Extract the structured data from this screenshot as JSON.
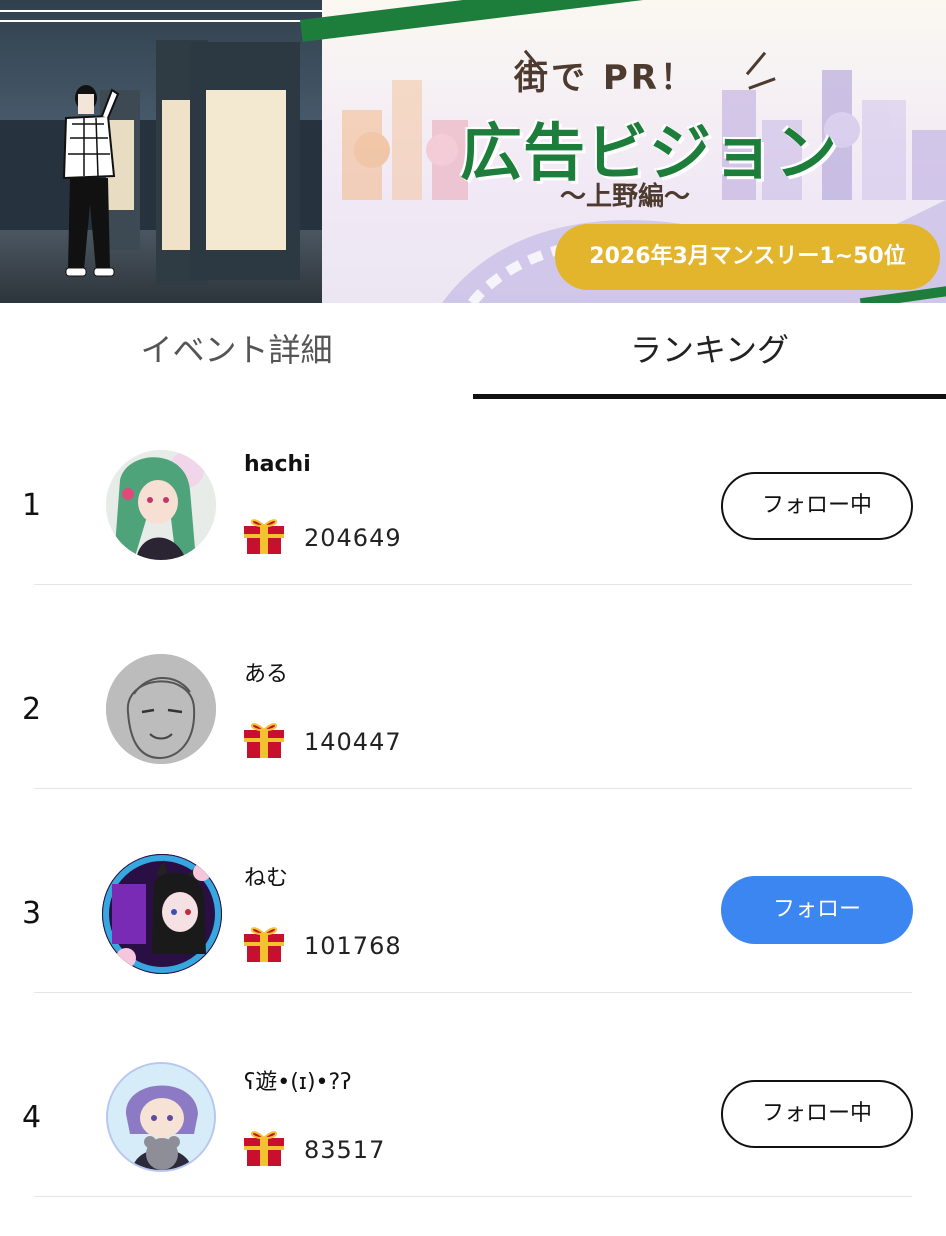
{
  "banner": {
    "headline_small": "街で PR！",
    "headline_big": "広告ビジョン",
    "subtitle": "〜上野編〜",
    "badge": "2026年3月マンスリー1~50位",
    "accent_green": "#1d7d3a",
    "badge_color": "#e3b52c"
  },
  "tabs": [
    {
      "label": "イベント詳細",
      "active": false
    },
    {
      "label": "ランキング",
      "active": true
    }
  ],
  "ranking": [
    {
      "rank": "1",
      "name": "hachi",
      "score": "204649",
      "button": "フォロー中",
      "following": true,
      "avatar": "avatar-green-hair"
    },
    {
      "rank": "2",
      "name": "ある",
      "score": "140447",
      "button": "",
      "following": null,
      "avatar": "avatar-sketch"
    },
    {
      "rank": "3",
      "name": "ねむ",
      "score": "101768",
      "button": "フォロー",
      "following": false,
      "avatar": "avatar-neon"
    },
    {
      "rank": "4",
      "name": "ʕ遊•(ɪ)•?ʔ",
      "score": "83517",
      "button": "フォロー中",
      "following": true,
      "avatar": "avatar-purple-hair"
    }
  ],
  "icons": {
    "gift": "gift-icon"
  },
  "colors": {
    "follow_button": "#3b86f0",
    "gift_red": "#c8102e",
    "gift_gold": "#f2c230"
  }
}
